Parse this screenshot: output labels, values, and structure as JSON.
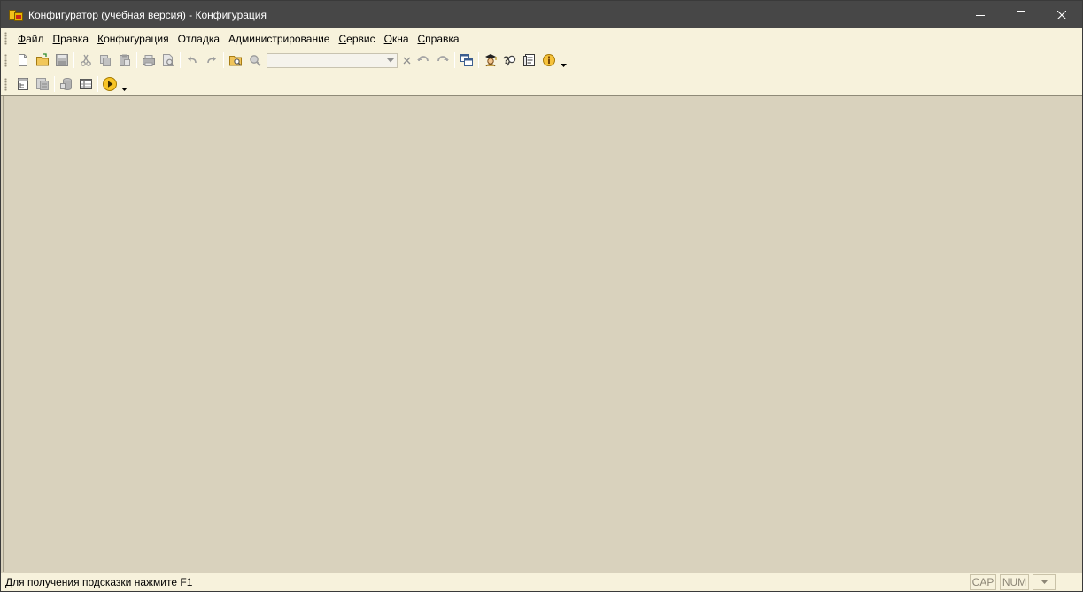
{
  "window": {
    "title": "Конфигуратор (учебная версия) - Конфигурация"
  },
  "menu": [
    {
      "id": "file",
      "pre": "",
      "u": "Ф",
      "rest": "айл"
    },
    {
      "id": "edit",
      "pre": "",
      "u": "П",
      "rest": "равка"
    },
    {
      "id": "configuration",
      "pre": "",
      "u": "К",
      "rest": "онфигурация"
    },
    {
      "id": "debug",
      "pre": "",
      "u": "",
      "rest": "Отладка"
    },
    {
      "id": "administration",
      "pre": "",
      "u": "",
      "rest": "Администрирование"
    },
    {
      "id": "service",
      "pre": "",
      "u": "С",
      "rest": "ервис"
    },
    {
      "id": "windows",
      "pre": "",
      "u": "О",
      "rest": "кна"
    },
    {
      "id": "help",
      "pre": "",
      "u": "С",
      "rest": "правка"
    }
  ],
  "search": {
    "value": ""
  },
  "statusbar": {
    "hint": "Для получения подсказки нажмите F1",
    "caps": "CAP",
    "num": "NUM"
  },
  "colors": {
    "titlebar": "#474747",
    "chrome": "#f7f2dc",
    "workspace": "#d9d2bd"
  }
}
